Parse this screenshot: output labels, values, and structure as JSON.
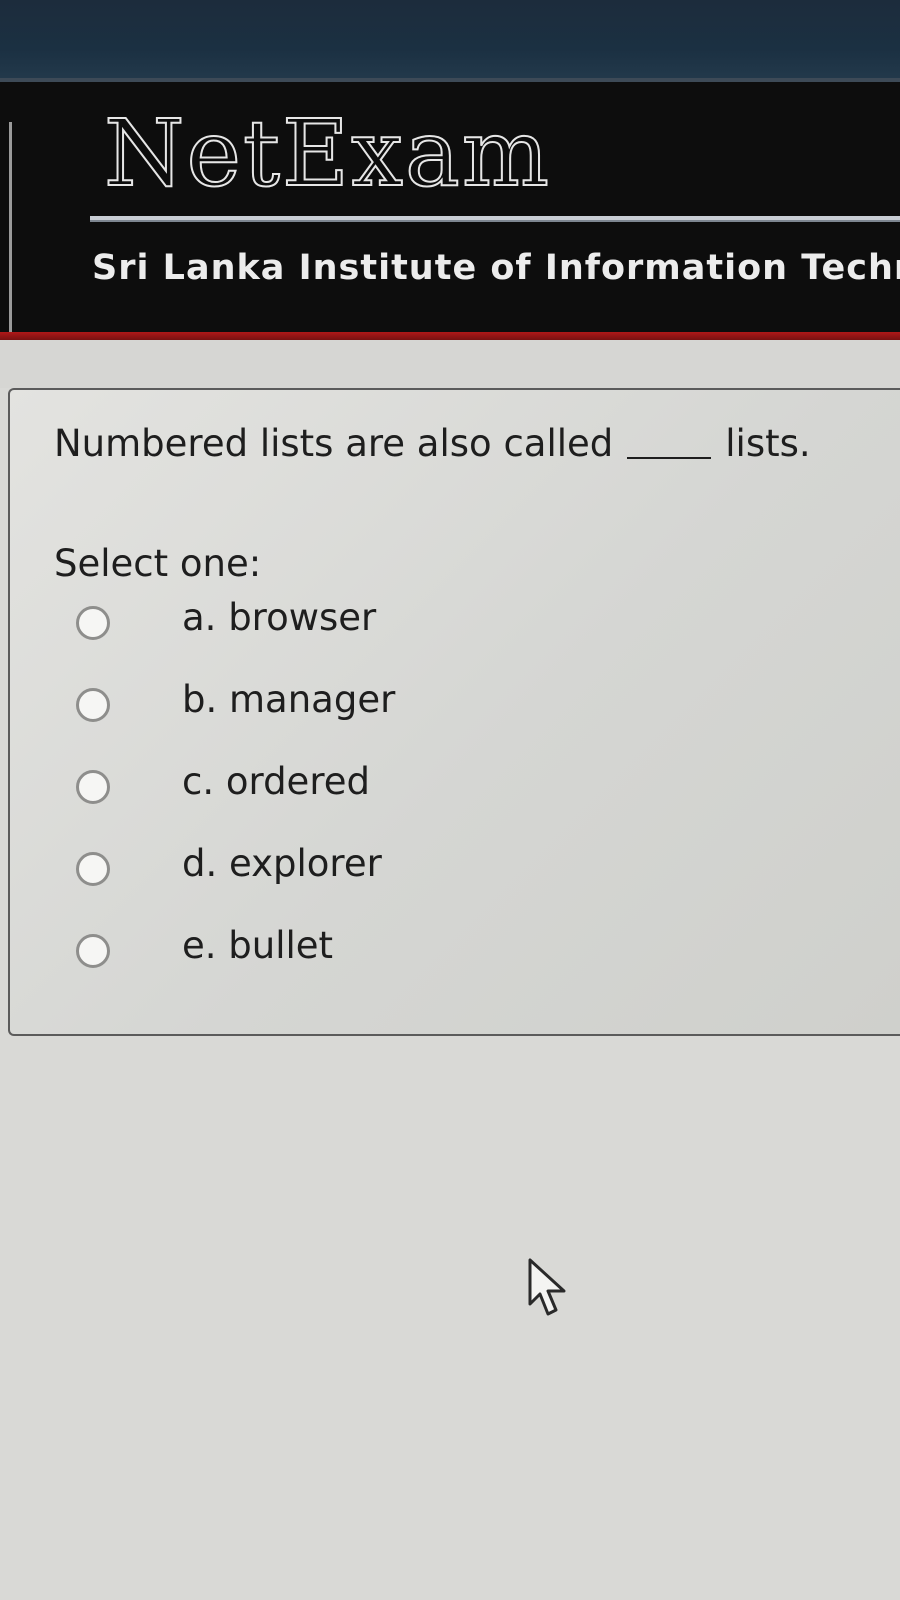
{
  "header": {
    "logo": "NetExam",
    "institute": "Sri Lanka Institute of Information Techno"
  },
  "question": {
    "text_before": "Numbered lists are also called",
    "text_after": "lists.",
    "prompt": "Select one:",
    "options": [
      {
        "label": "a. browser"
      },
      {
        "label": "b. manager"
      },
      {
        "label": "c. ordered"
      },
      {
        "label": "d. explorer"
      },
      {
        "label": "e. bullet"
      }
    ]
  },
  "colors": {
    "header_bg": "#0d0d0d",
    "accent_red": "#b01818",
    "page_bg": "#d9d9d6"
  },
  "icons": {
    "cursor": "mouse-pointer-icon",
    "radio": "radio-unchecked-icon"
  }
}
